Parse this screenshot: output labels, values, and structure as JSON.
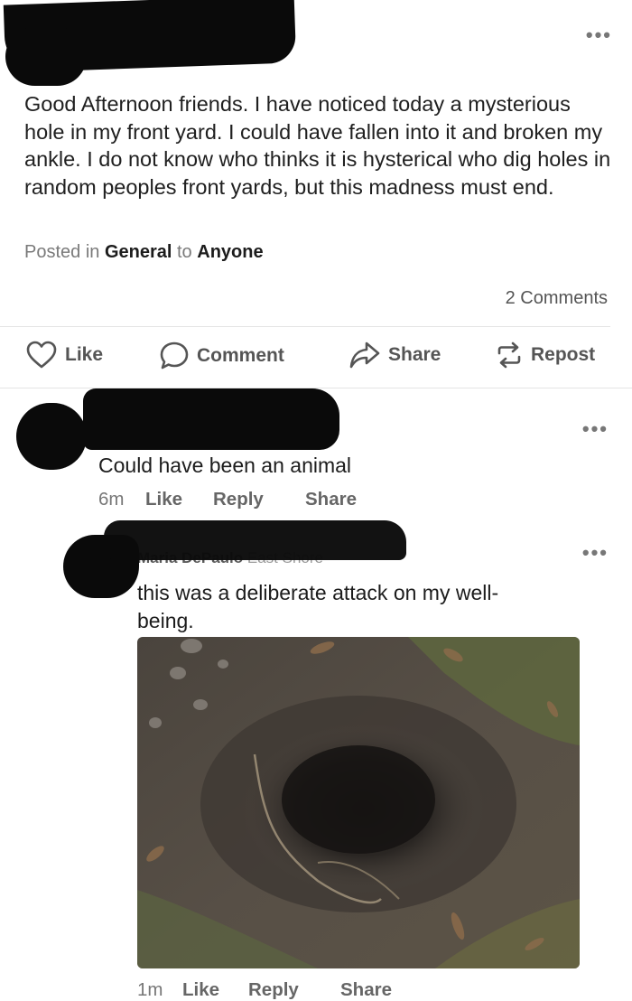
{
  "post": {
    "text": "Good Afternoon friends. I have noticed today a mysterious hole in my front yard. I could have fallen into it and broken my ankle. I do not know who thinks it is hysterical who dig holes in random peoples front yards, but this madness must end.",
    "meta_prefix": "Posted in",
    "category": "General",
    "meta_to": "to",
    "audience": "Anyone",
    "comment_count": "2 Comments",
    "more_icon": "more-horizontal-icon"
  },
  "actions": {
    "like": "Like",
    "comment": "Comment",
    "share": "Share",
    "repost": "Repost"
  },
  "comments": [
    {
      "text": "Could have been an animal",
      "time": "6m",
      "like": "Like",
      "reply": "Reply",
      "share": "Share"
    },
    {
      "author": "Maria DePaulo",
      "location": "East Shore",
      "text_line1": "this was a deliberate attack on my well-",
      "text_line2": "being.",
      "time": "1m",
      "like": "Like",
      "reply": "Reply",
      "share": "Share"
    }
  ],
  "colors": {
    "text": "#1c1c1c",
    "muted": "#777777",
    "redaction": "#0a0a0a"
  }
}
